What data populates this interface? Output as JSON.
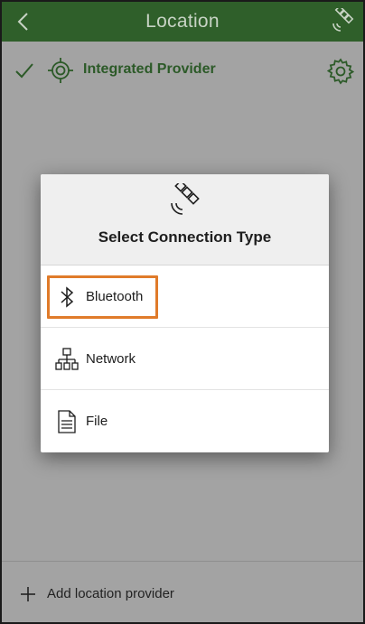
{
  "header": {
    "title": "Location",
    "back_icon": "chevron-left-icon",
    "right_icon": "satellite-icon",
    "background": "#2f5f2a"
  },
  "provider": {
    "label": "Integrated Provider",
    "selected": true,
    "color": "#2c5a28"
  },
  "dialog": {
    "heading": "Select Connection Type",
    "options": [
      {
        "label": "Bluetooth",
        "icon": "bluetooth-icon",
        "highlighted": true
      },
      {
        "label": "Network",
        "icon": "network-icon",
        "highlighted": false
      },
      {
        "label": "File",
        "icon": "file-icon",
        "highlighted": false
      }
    ],
    "highlight_color": "#e07b2a"
  },
  "footer": {
    "add_label": "Add location provider"
  }
}
